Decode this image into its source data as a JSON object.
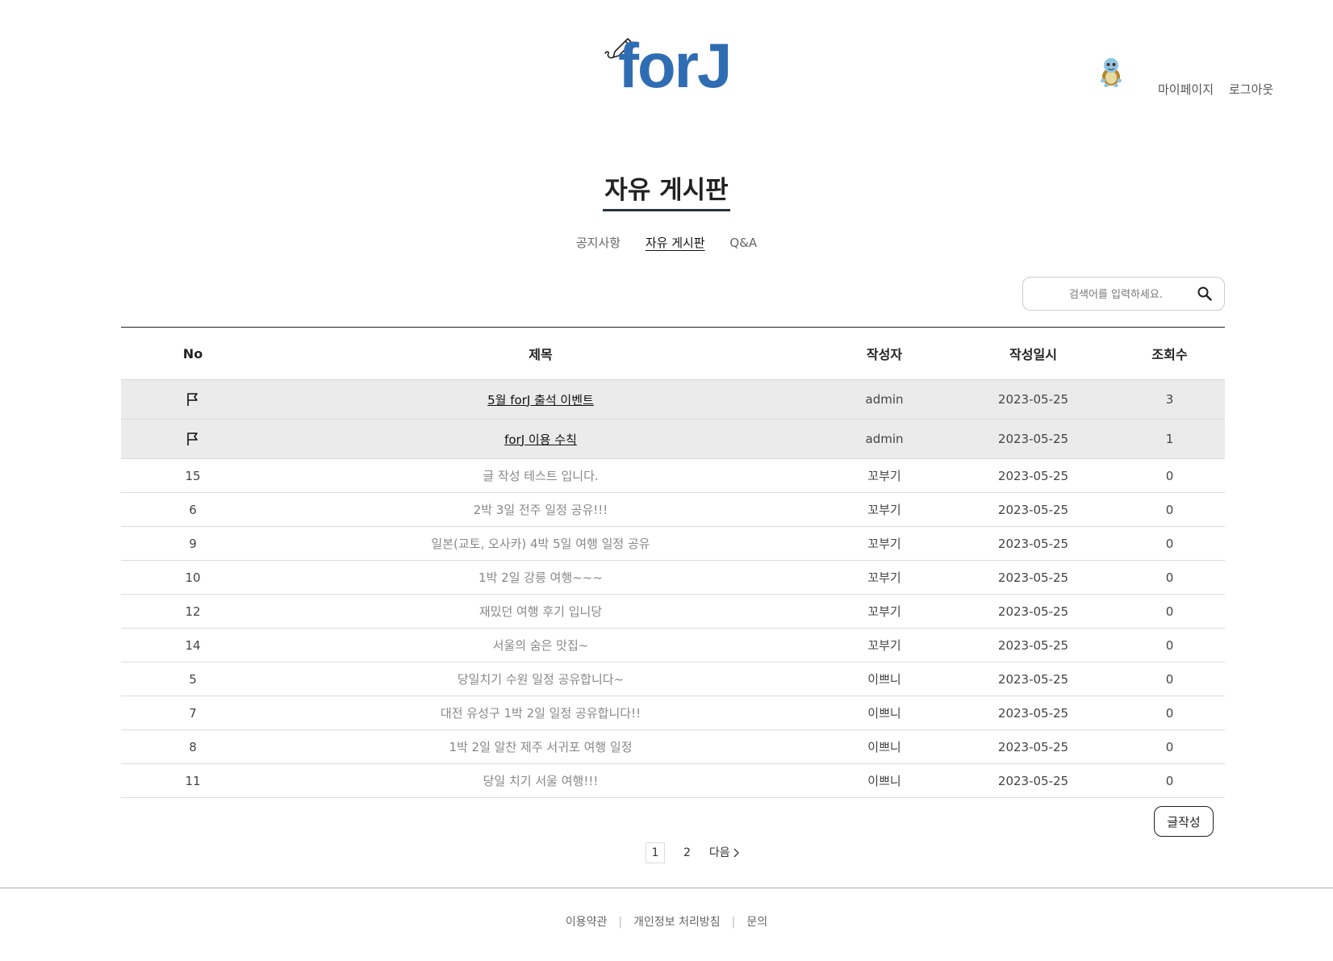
{
  "header": {
    "logo_text": "forJ",
    "mypage_label": "마이페이지",
    "logout_label": "로그아웃",
    "brand_color": "#2f6db3"
  },
  "board": {
    "title": "자유 게시판",
    "tabs": [
      {
        "label": "공지사항",
        "active": false
      },
      {
        "label": "자유 게시판",
        "active": true
      },
      {
        "label": "Q&A",
        "active": false
      }
    ]
  },
  "search": {
    "placeholder": "검색어를 입력하세요.",
    "icon": "search-icon"
  },
  "table": {
    "headers": [
      "No",
      "제목",
      "작성자",
      "작성일시",
      "조회수"
    ],
    "notices": [
      {
        "icon": "flag-icon",
        "title": "5월 forJ 출석 이벤트",
        "author": "admin",
        "date": "2023-05-25",
        "views": "3"
      },
      {
        "icon": "flag-icon",
        "title": "forJ 이용 수칙",
        "author": "admin",
        "date": "2023-05-25",
        "views": "1"
      }
    ],
    "rows": [
      {
        "no": "15",
        "title": "글 작성 테스트 입니다.",
        "author": "꼬부기",
        "date": "2023-05-25",
        "views": "0"
      },
      {
        "no": "6",
        "title": "2박 3일 전주 일정 공유!!!",
        "author": "꼬부기",
        "date": "2023-05-25",
        "views": "0"
      },
      {
        "no": "9",
        "title": "일본(교토, 오사카) 4박 5일 여행 일정 공유",
        "author": "꼬부기",
        "date": "2023-05-25",
        "views": "0"
      },
      {
        "no": "10",
        "title": "1박 2일 강릉 여행~~~",
        "author": "꼬부기",
        "date": "2023-05-25",
        "views": "0"
      },
      {
        "no": "12",
        "title": "재밌던 여행 후기 입니당",
        "author": "꼬부기",
        "date": "2023-05-25",
        "views": "0"
      },
      {
        "no": "14",
        "title": "서울의 숨은 맛집~",
        "author": "꼬부기",
        "date": "2023-05-25",
        "views": "0"
      },
      {
        "no": "5",
        "title": "당일치기 수원 일정 공유합니다~",
        "author": "이쁘니",
        "date": "2023-05-25",
        "views": "0"
      },
      {
        "no": "7",
        "title": "대전 유성구 1박 2일 일정 공유합니다!!",
        "author": "이쁘니",
        "date": "2023-05-25",
        "views": "0"
      },
      {
        "no": "8",
        "title": "1박 2일 알찬 제주 서귀포 여행 일정",
        "author": "이쁘니",
        "date": "2023-05-25",
        "views": "0"
      },
      {
        "no": "11",
        "title": "당일 치기 서울 여행!!!",
        "author": "이쁘니",
        "date": "2023-05-25",
        "views": "0"
      }
    ]
  },
  "write_button": "글작성",
  "pagination": {
    "pages": [
      "1",
      "2"
    ],
    "current": "1",
    "next_label": "다음"
  },
  "footer": {
    "links": [
      "이용약관",
      "개인정보 처리방침",
      "문의"
    ]
  }
}
